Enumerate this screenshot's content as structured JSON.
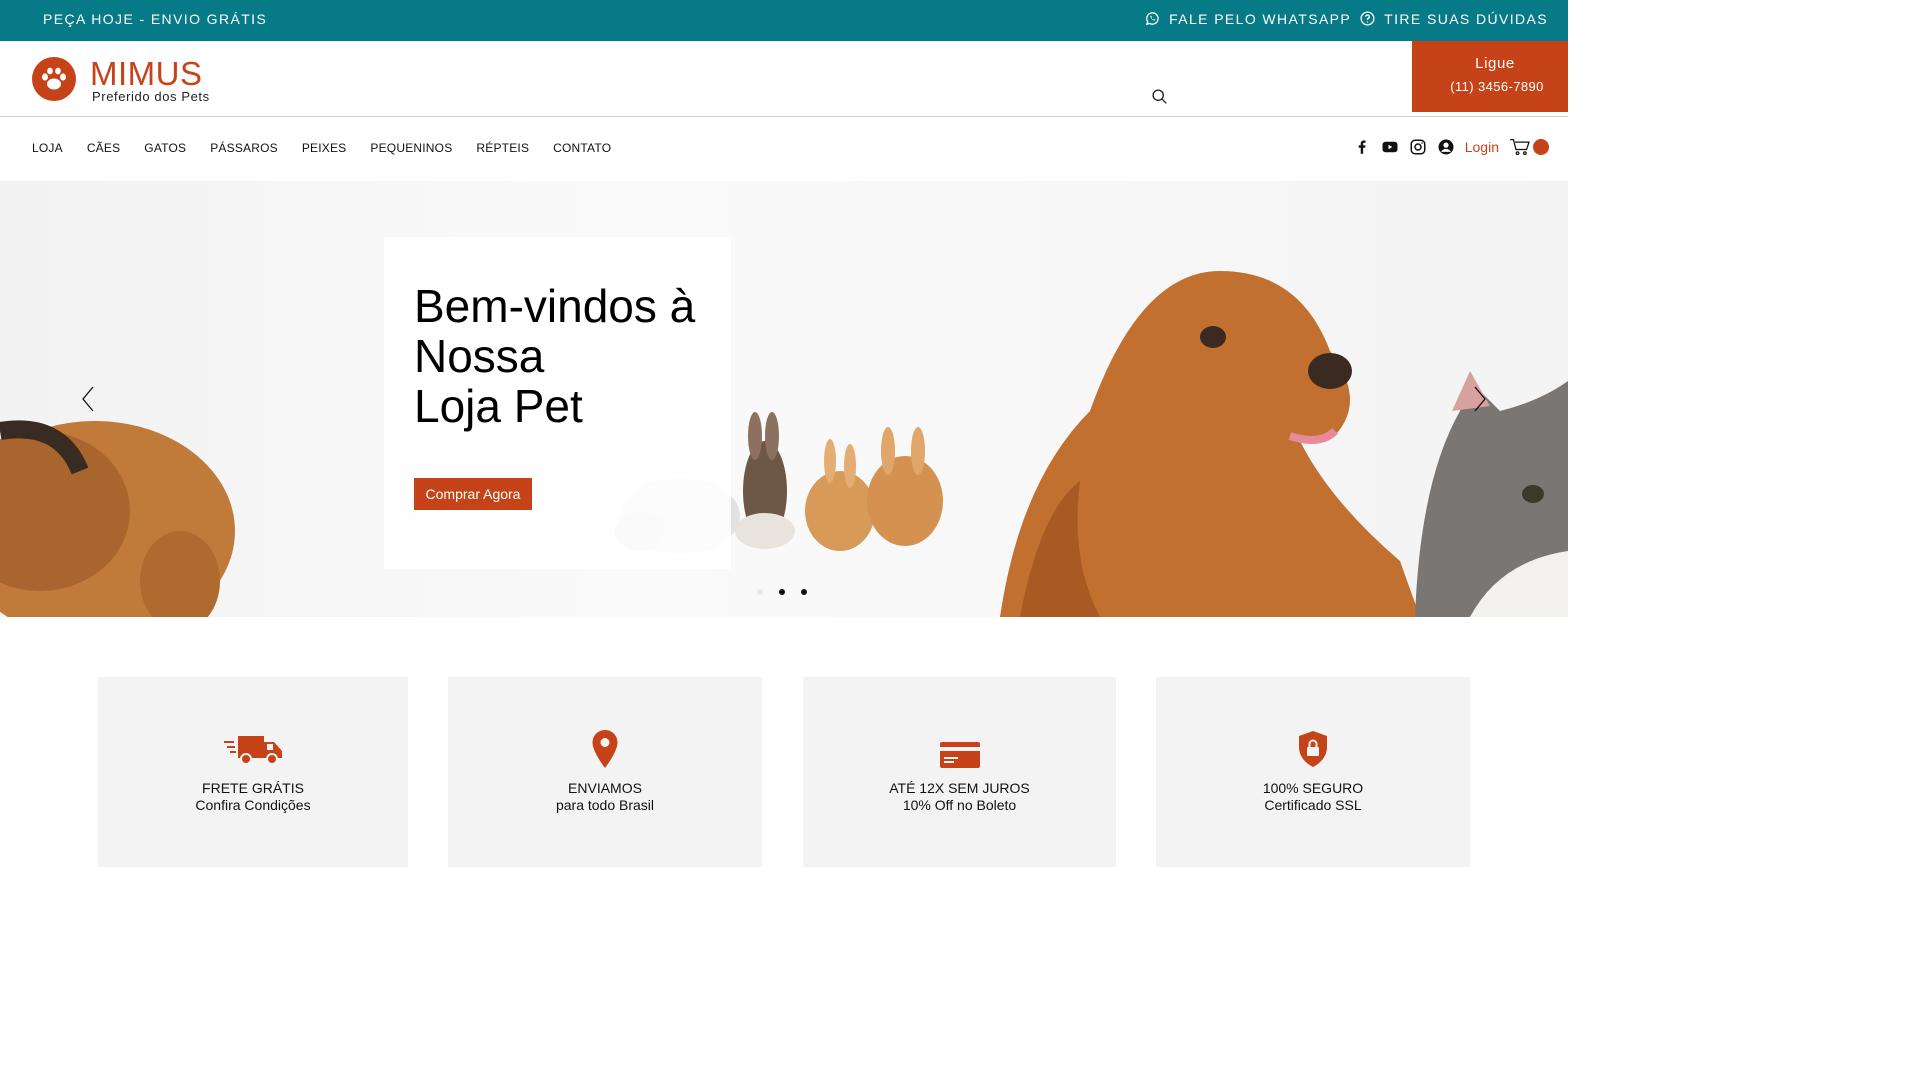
{
  "topbar": {
    "promo": "PEÇA HOJE - ENVIO GRÁTIS",
    "whatsapp": "FALE PELO WHATSAPP",
    "faq": "TIRE SUAS DÚVIDAS",
    "bg_color": "#067a86"
  },
  "header": {
    "brand": "MIMUS",
    "tagline": "Preferido dos Pets",
    "call_label": "Ligue",
    "call_number": "(11) 3456-7890",
    "accent_color": "#c6431a",
    "icons": [
      "paw-logo-icon",
      "search-icon"
    ]
  },
  "nav": {
    "items": [
      "LOJA",
      "CÃES",
      "GATOS",
      "PÁSSAROS",
      "PEIXES",
      "PEQUENINOS",
      "RÉPTEIS",
      "CONTATO"
    ],
    "login": "Login",
    "icons": [
      "facebook-icon",
      "youtube-icon",
      "instagram-icon",
      "user-icon",
      "cart-icon"
    ]
  },
  "hero": {
    "title_lines": [
      "Bem-vindos à",
      "Nossa",
      "Loja Pet"
    ],
    "cta": "Comprar Agora",
    "slides": 3,
    "active_slide": 1
  },
  "features": [
    {
      "icon": "truck-icon",
      "line1": "FRETE GRÁTIS",
      "line2": "Confira Condições"
    },
    {
      "icon": "location-pin-icon",
      "line1": "ENVIAMOS",
      "line2": "para todo Brasil"
    },
    {
      "icon": "credit-card-icon",
      "line1": "ATÉ 12X SEM JUROS",
      "line2": "10% Off no Boleto"
    },
    {
      "icon": "lock-shield-icon",
      "line1": "100% SEGURO",
      "line2": "Certificado SSL"
    }
  ]
}
